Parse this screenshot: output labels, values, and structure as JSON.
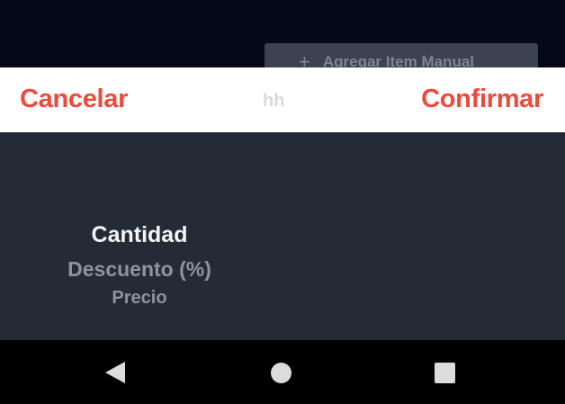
{
  "background": {
    "add_item_button": {
      "icon": "plus-icon",
      "label": "Agregar Item Manual"
    }
  },
  "toolbar": {
    "cancel_label": "Cancelar",
    "title": "hh",
    "confirm_label": "Confirmar"
  },
  "picker": {
    "options": [
      "Cantidad",
      "Descuento (%)",
      "Precio"
    ],
    "selected": "Cantidad"
  },
  "navbar": {
    "back_icon": "back-triangle-icon",
    "home_icon": "home-circle-icon",
    "recents_icon": "recents-square-icon"
  },
  "colors": {
    "accent": "#ee4a3c",
    "sheet_bg": "#252b36",
    "top_bg": "#050818",
    "toolbar_bg": "#ffffff"
  }
}
